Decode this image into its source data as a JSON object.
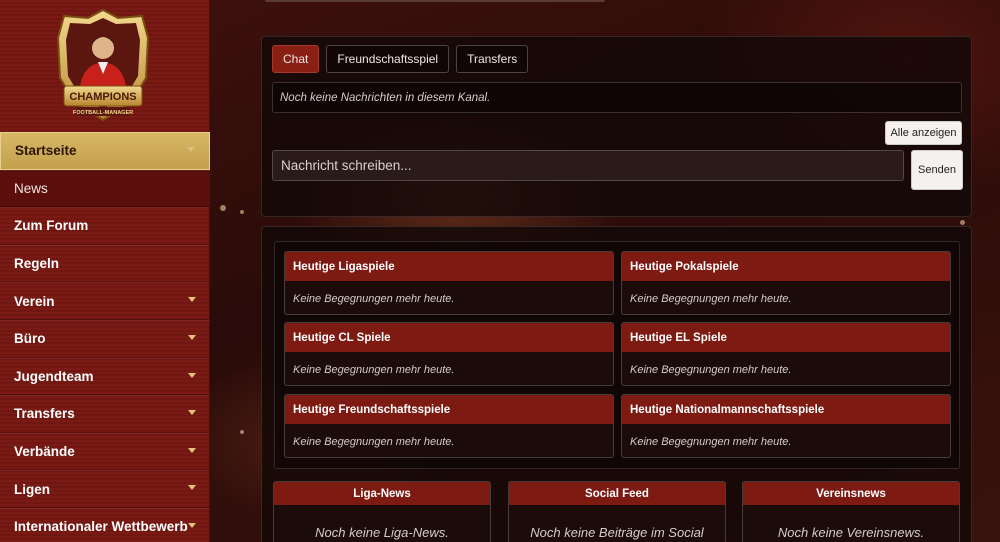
{
  "brand": {
    "logo_line1": "CHAMPIONS",
    "logo_line2": "FOOTBALL-MANAGER",
    "gold": "#d7b765",
    "primary_red": "#7d1b13"
  },
  "sidebar": {
    "items": [
      {
        "label": "Startseite",
        "caret": true
      },
      {
        "label": "News",
        "caret": false
      },
      {
        "label": "Zum Forum",
        "caret": false
      },
      {
        "label": "Regeln",
        "caret": false
      },
      {
        "label": "Verein",
        "caret": true
      },
      {
        "label": "Büro",
        "caret": true
      },
      {
        "label": "Jugendteam",
        "caret": true
      },
      {
        "label": "Transfers",
        "caret": true
      },
      {
        "label": "Verbände",
        "caret": true
      },
      {
        "label": "Ligen",
        "caret": true
      },
      {
        "label": "Internationaler Wettbewerb",
        "caret": true
      }
    ]
  },
  "chat": {
    "tabs": [
      {
        "label": "Chat",
        "active": true
      },
      {
        "label": "Freundschaftsspiel",
        "active": false
      },
      {
        "label": "Transfers",
        "active": false
      }
    ],
    "empty_message": "Noch keine Nachrichten in diesem Kanal.",
    "show_all_label": "Alle anzeigen",
    "input_placeholder": "Nachricht schreiben...",
    "send_label": "Senden"
  },
  "matches": [
    {
      "title": "Heutige Ligaspiele",
      "body": "Keine Begegnungen mehr heute."
    },
    {
      "title": "Heutige Pokalspiele",
      "body": "Keine Begegnungen mehr heute."
    },
    {
      "title": "Heutige CL Spiele",
      "body": "Keine Begegnungen mehr heute."
    },
    {
      "title": "Heutige EL Spiele",
      "body": "Keine Begegnungen mehr heute."
    },
    {
      "title": "Heutige Freundschaftsspiele",
      "body": "Keine Begegnungen mehr heute."
    },
    {
      "title": "Heutige Nationalmannschaftsspiele",
      "body": "Keine Begegnungen mehr heute."
    }
  ],
  "news": [
    {
      "title": "Liga-News",
      "body": "Noch keine Liga-News."
    },
    {
      "title": "Social Feed",
      "body": "Noch keine Beiträge im Social"
    },
    {
      "title": "Vereinsnews",
      "body": "Noch keine Vereinsnews."
    }
  ]
}
